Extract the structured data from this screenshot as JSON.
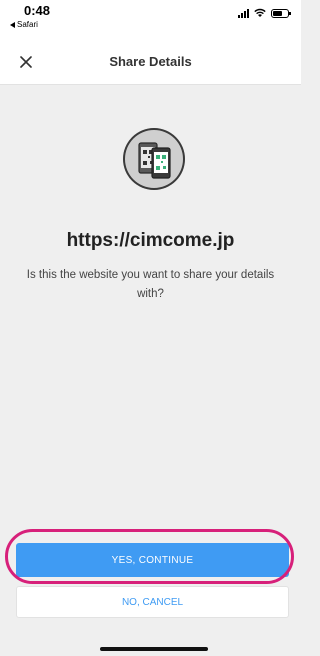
{
  "status": {
    "time": "0:48",
    "back_app": "Safari",
    "battery_level": 0.6
  },
  "navbar": {
    "title": "Share Details",
    "close_icon": "close-icon"
  },
  "content": {
    "illustration_icon": "phone-qr-icon",
    "url": "https://cimcome.jp",
    "question": "Is this the website you want to share your details with?"
  },
  "actions": {
    "yes_label": "YES, CONTINUE",
    "no_label": "NO, CANCEL"
  },
  "colors": {
    "accent": "#3f9bf3",
    "highlight": "#d7207a",
    "background": "#efefef"
  }
}
